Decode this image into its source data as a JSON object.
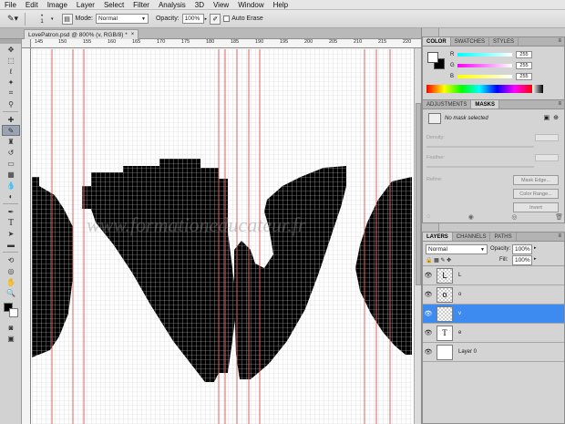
{
  "menubar": {
    "items": [
      "File",
      "Edit",
      "Image",
      "Layer",
      "Select",
      "Filter",
      "Analysis",
      "3D",
      "View",
      "Window",
      "Help"
    ]
  },
  "options_bar": {
    "brush_size": "1",
    "mode_label": "Mode:",
    "mode_value": "Normal",
    "opacity_label": "Opacity:",
    "opacity_value": "100%",
    "auto_erase_label": "Auto Erase"
  },
  "document": {
    "tab_title": "LovePatron.psd @ 800% (v, RGB/8) *",
    "ruler_numbers": [
      "145",
      "150",
      "155",
      "160",
      "165",
      "170",
      "175",
      "180",
      "185",
      "190",
      "195",
      "200",
      "205",
      "210",
      "215",
      "220"
    ],
    "watermark": "www.formationeducateur.fr"
  },
  "color_panel": {
    "tabs": [
      "COLOR",
      "SWATCHES",
      "STYLES"
    ],
    "channels": [
      {
        "name": "R",
        "value": "255"
      },
      {
        "name": "G",
        "value": "255"
      },
      {
        "name": "B",
        "value": "255"
      }
    ],
    "accent": "#00b7e6"
  },
  "masks_panel": {
    "tabs": [
      "ADJUSTMENTS",
      "MASKS"
    ],
    "status": "No mask selected",
    "density_label": "Density:",
    "feather_label": "Feather:",
    "refine_label": "Refine:",
    "mask_edge_button": "Mask Edge...",
    "color_range_button": "Color Range...",
    "invert_button": "Invert"
  },
  "layers_panel": {
    "tabs": [
      "LAYERS",
      "CHANNELS",
      "PATHS"
    ],
    "blend_mode": "Normal",
    "opacity_label": "Opacity:",
    "opacity_value": "100%",
    "fill_label": "Fill:",
    "fill_value": "100%",
    "layers": [
      {
        "name": "L",
        "thumb": "L",
        "selected": false,
        "type": "pixel"
      },
      {
        "name": "o",
        "thumb": "o",
        "selected": false,
        "type": "pixel"
      },
      {
        "name": "v",
        "thumb": "",
        "selected": true,
        "type": "pixel"
      },
      {
        "name": "e",
        "thumb": "T",
        "selected": false,
        "type": "text"
      },
      {
        "name": "Layer 0",
        "thumb": "",
        "selected": false,
        "type": "fill"
      }
    ],
    "selected_color": "#3d8bf0"
  }
}
